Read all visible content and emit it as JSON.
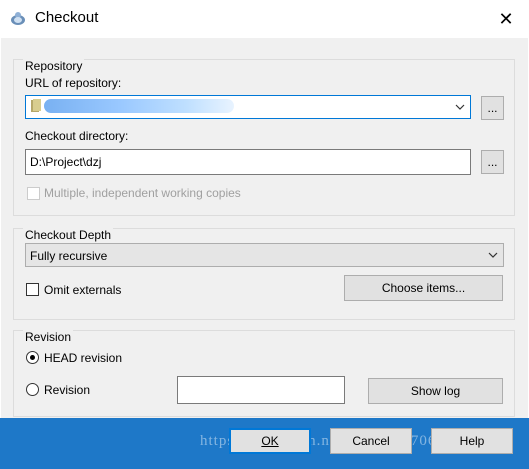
{
  "window": {
    "title": "Checkout",
    "close_glyph": "✕",
    "accent": "#0078d7"
  },
  "repository": {
    "group_title": "Repository",
    "url_label": "URL of repository:",
    "url_value": "",
    "browse_label": "...",
    "dir_label": "Checkout directory:",
    "dir_value": "D:\\Project\\dzj",
    "dir_browse_label": "...",
    "multiple_label": "Multiple, independent working copies",
    "multiple_checked": false
  },
  "depth": {
    "group_title": "Checkout Depth",
    "selected": "Fully recursive",
    "omit_label": "Omit externals",
    "omit_checked": false,
    "choose_label": "Choose items..."
  },
  "revision": {
    "group_title": "Revision",
    "head_label": "HEAD revision",
    "head_selected": true,
    "revision_label": "Revision",
    "revision_value": "",
    "show_log_label": "Show log"
  },
  "footer": {
    "ok_label": "OK",
    "cancel_label": "Cancel",
    "help_label": "Help",
    "watermark": "https://blog.csdn.net/sl735510706",
    "background": "#1e78c8"
  }
}
